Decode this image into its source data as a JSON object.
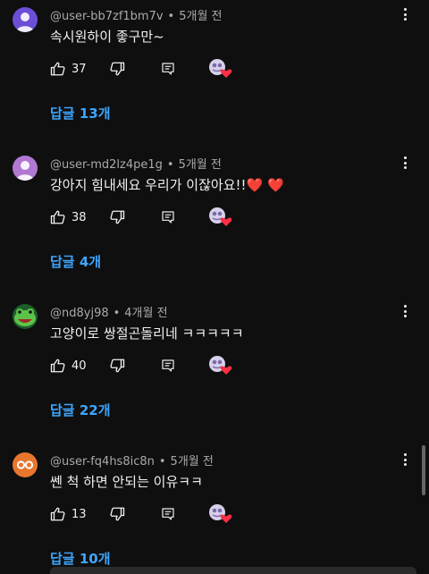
{
  "comments": [
    {
      "handle": "@user-bb7zf1bm7v",
      "time": "5개월 전",
      "text": "속시원하이 좋구만~",
      "likes": "37",
      "replies": "답글 13개",
      "avatar_icon": "purple-silhouette-avatar",
      "avatar_color": "#6c4fd6"
    },
    {
      "handle": "@user-md2lz4pe1g",
      "time": "5개월 전",
      "text": "강아지 힘내세요 우리가 이잖아요!!",
      "text_emoji": "❤️ ❤️",
      "likes": "38",
      "replies": "답글 4개",
      "avatar_icon": "lavender-silhouette-avatar",
      "avatar_color": "#b178d3"
    },
    {
      "handle": "@nd8yj98",
      "time": "4개월 전",
      "text": "고양이로 쌍절곤돌리네 ㅋㅋㅋㅋㅋ",
      "likes": "40",
      "replies": "답글 22개",
      "avatar_icon": "green-frog-avatar",
      "avatar_color": "#4caf50"
    },
    {
      "handle": "@user-fq4hs8ic8n",
      "time": "5개월 전",
      "text": "쎈 척 하면 안되는 이유ㅋㅋ",
      "likes": "13",
      "replies": "답글 10개",
      "avatar_icon": "orange-eyes-avatar",
      "avatar_color": "#e8762d"
    }
  ],
  "colors": {
    "background": "#0f0f0f",
    "link": "#3ea6ff",
    "muted": "#aaaaaa",
    "text": "#f1f1f1",
    "heart": "#ff2f45"
  },
  "icons": {
    "like": "thumbs-up-icon",
    "dislike": "thumbs-down-icon",
    "reply": "reply-comment-icon",
    "creator_heart": "creator-heart-icon",
    "more": "more-vertical-icon"
  }
}
